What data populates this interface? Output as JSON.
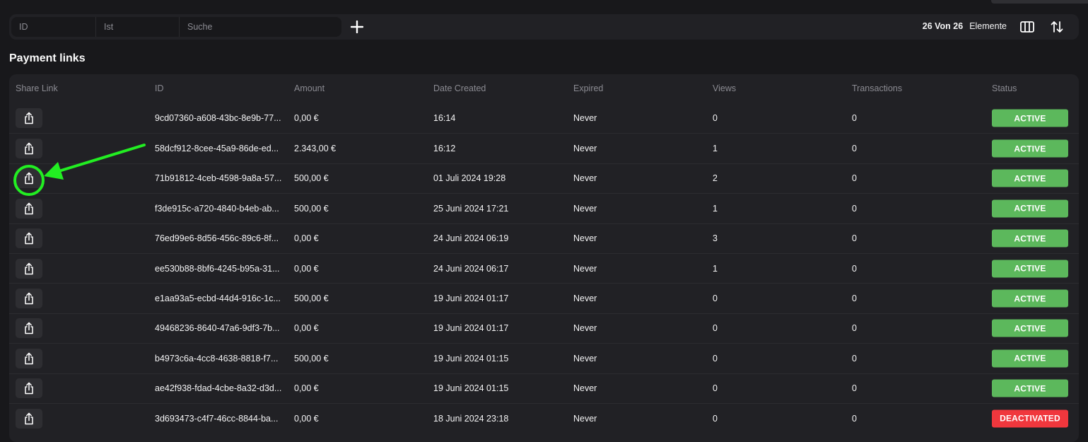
{
  "filter": {
    "id_placeholder": "ID",
    "ist_placeholder": "Ist",
    "search_placeholder": "Suche",
    "count_text": "26 Von 26",
    "count_suffix": "Elemente"
  },
  "page": {
    "title": "Payment links"
  },
  "table": {
    "columns": {
      "share": "Share Link",
      "id": "ID",
      "amount": "Amount",
      "date": "Date Created",
      "expired": "Expired",
      "views": "Views",
      "transactions": "Transactions",
      "status": "Status"
    },
    "rows": [
      {
        "id": "9cd07360-a608-43bc-8e9b-77...",
        "amount": "0,00 €",
        "date": "16:14",
        "expired": "Never",
        "views": "0",
        "transactions": "0",
        "status": "ACTIVE"
      },
      {
        "id": "58dcf912-8cee-45a9-86de-ed...",
        "amount": "2.343,00 €",
        "date": "16:12",
        "expired": "Never",
        "views": "1",
        "transactions": "0",
        "status": "ACTIVE"
      },
      {
        "id": "71b91812-4ceb-4598-9a8a-57...",
        "amount": "500,00 €",
        "date": "01 Juli 2024 19:28",
        "expired": "Never",
        "views": "2",
        "transactions": "0",
        "status": "ACTIVE"
      },
      {
        "id": "f3de915c-a720-4840-b4eb-ab...",
        "amount": "500,00 €",
        "date": "25 Juni 2024 17:21",
        "expired": "Never",
        "views": "1",
        "transactions": "0",
        "status": "ACTIVE"
      },
      {
        "id": "76ed99e6-8d56-456c-89c6-8f...",
        "amount": "0,00 €",
        "date": "24 Juni 2024 06:19",
        "expired": "Never",
        "views": "3",
        "transactions": "0",
        "status": "ACTIVE"
      },
      {
        "id": "ee530b88-8bf6-4245-b95a-31...",
        "amount": "0,00 €",
        "date": "24 Juni 2024 06:17",
        "expired": "Never",
        "views": "1",
        "transactions": "0",
        "status": "ACTIVE"
      },
      {
        "id": "e1aa93a5-ecbd-44d4-916c-1c...",
        "amount": "500,00 €",
        "date": "19 Juni 2024 01:17",
        "expired": "Never",
        "views": "0",
        "transactions": "0",
        "status": "ACTIVE"
      },
      {
        "id": "49468236-8640-47a6-9df3-7b...",
        "amount": "0,00 €",
        "date": "19 Juni 2024 01:17",
        "expired": "Never",
        "views": "0",
        "transactions": "0",
        "status": "ACTIVE"
      },
      {
        "id": "b4973c6a-4cc8-4638-8818-f7...",
        "amount": "500,00 €",
        "date": "19 Juni 2024 01:15",
        "expired": "Never",
        "views": "0",
        "transactions": "0",
        "status": "ACTIVE"
      },
      {
        "id": "ae42f938-fdad-4cbe-8a32-d3d...",
        "amount": "0,00 €",
        "date": "19 Juni 2024 01:15",
        "expired": "Never",
        "views": "0",
        "transactions": "0",
        "status": "ACTIVE"
      },
      {
        "id": "3d693473-c4f7-46cc-8844-ba...",
        "amount": "0,00 €",
        "date": "18 Juni 2024 23:18",
        "expired": "Never",
        "views": "0",
        "transactions": "0",
        "status": "DEACTIVATED"
      }
    ]
  },
  "colors": {
    "active": "#5cb85c",
    "deactivated": "#f0373d",
    "annotation": "#22ee22"
  },
  "icons": {
    "share": "share-icon",
    "add": "plus-icon",
    "columns": "columns-icon",
    "sort": "sort-icon"
  }
}
